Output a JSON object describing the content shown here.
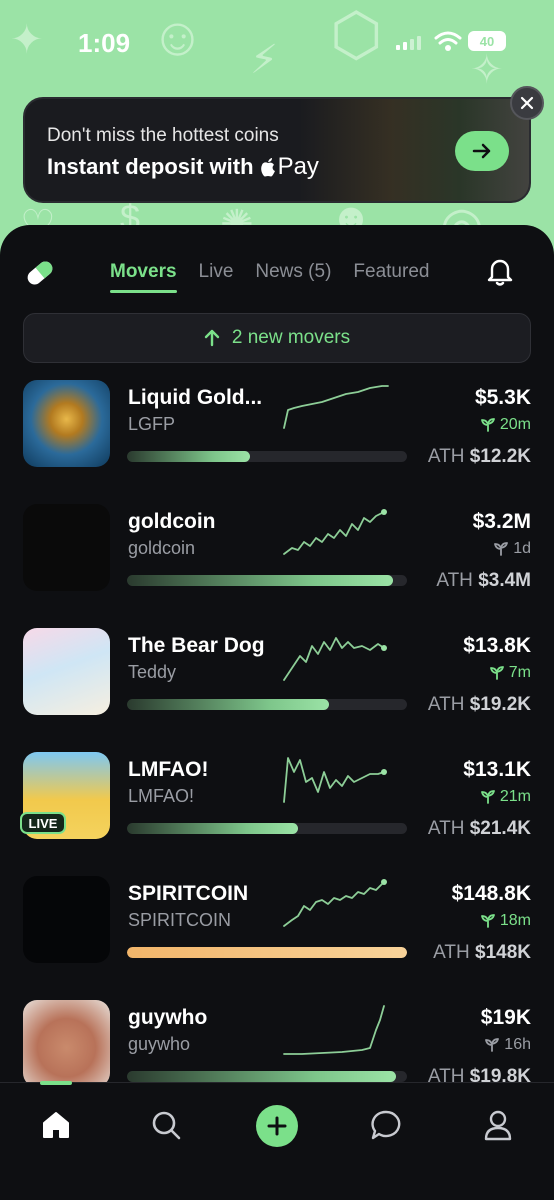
{
  "status_bar": {
    "time": "1:09",
    "battery": "40"
  },
  "banner": {
    "line1": "Don't miss the hottest coins",
    "line2": "Instant deposit with",
    "pay_label": "Pay",
    "arrow_icon": "arrow-right-icon",
    "close_icon": "close-icon"
  },
  "tabs": [
    {
      "label": "Movers",
      "active": true
    },
    {
      "label": "Live",
      "active": false
    },
    {
      "label": "News (5)",
      "active": false
    },
    {
      "label": "Featured",
      "active": false
    }
  ],
  "new_movers": {
    "label": "2 new movers"
  },
  "coins": [
    {
      "name": "Liquid Gold...",
      "ticker": "LGFP",
      "price": "$5.3K",
      "age": "20m",
      "age_color": "green",
      "ath_label": "ATH",
      "ath_value": "$12.2K",
      "progress": 0.44,
      "bar_color": "green",
      "live": false
    },
    {
      "name": "goldcoin",
      "ticker": "goldcoin",
      "price": "$3.2M",
      "age": "1d",
      "age_color": "grey",
      "ath_label": "ATH",
      "ath_value": "$3.4M",
      "progress": 0.95,
      "bar_color": "green",
      "live": false
    },
    {
      "name": "The Bear Dog",
      "ticker": "Teddy",
      "price": "$13.8K",
      "age": "7m",
      "age_color": "green",
      "ath_label": "ATH",
      "ath_value": "$19.2K",
      "progress": 0.72,
      "bar_color": "green",
      "live": false
    },
    {
      "name": "LMFAO!",
      "ticker": "LMFAO!",
      "price": "$13.1K",
      "age": "21m",
      "age_color": "green",
      "ath_label": "ATH",
      "ath_value": "$21.4K",
      "progress": 0.61,
      "bar_color": "green",
      "live": true,
      "live_label": "LIVE"
    },
    {
      "name": "SPIRITCOIN",
      "ticker": "SPIRITCOIN",
      "price": "$148.8K",
      "age": "18m",
      "age_color": "green",
      "ath_label": "ATH",
      "ath_value": "$148K",
      "progress": 1.0,
      "bar_color": "orange",
      "live": false
    },
    {
      "name": "guywho",
      "ticker": "guywho",
      "price": "$19K",
      "age": "16h",
      "age_color": "grey",
      "ath_label": "ATH",
      "ath_value": "$19.8K",
      "progress": 0.96,
      "bar_color": "green",
      "live": false
    }
  ],
  "nav": [
    "home-icon",
    "search-icon",
    "plus-icon",
    "chat-icon",
    "profile-icon"
  ],
  "colors": {
    "accent": "#7be08a",
    "header_bg": "#9be3a6",
    "background": "#0e0f12",
    "ath_orange": "#f5c07a"
  }
}
